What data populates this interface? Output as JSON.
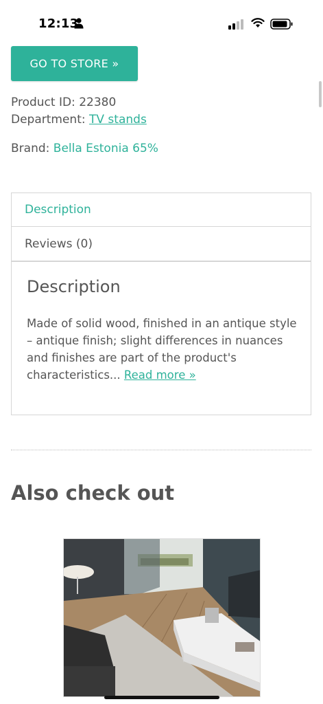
{
  "status_bar": {
    "time": "12:13",
    "person_icon": "person-fill-icon",
    "signal_icon": "cellular-signal-icon",
    "wifi_icon": "wifi-icon",
    "battery_icon": "battery-icon"
  },
  "store_button": {
    "label": "GO TO STORE »"
  },
  "product": {
    "id_label": "Product ID: ",
    "id_value": "22380",
    "department_label": "Department: ",
    "department_value": "TV stands",
    "brand_label": "Brand: ",
    "brand_value": "Bella Estonia 65%"
  },
  "tabs": [
    {
      "label": "Description",
      "active": true
    },
    {
      "label": "Reviews (0)",
      "active": false
    }
  ],
  "description": {
    "heading": "Description",
    "text": "Made of solid wood, finished in an antique style – antique finish; slight differences in nuances and finishes are part of the product's characteristics... ",
    "read_more": "Read more »"
  },
  "also_check_out": {
    "heading": "Also check out"
  },
  "colors": {
    "accent": "#2eb29a",
    "text": "#555555",
    "border": "#d6d6d6"
  }
}
